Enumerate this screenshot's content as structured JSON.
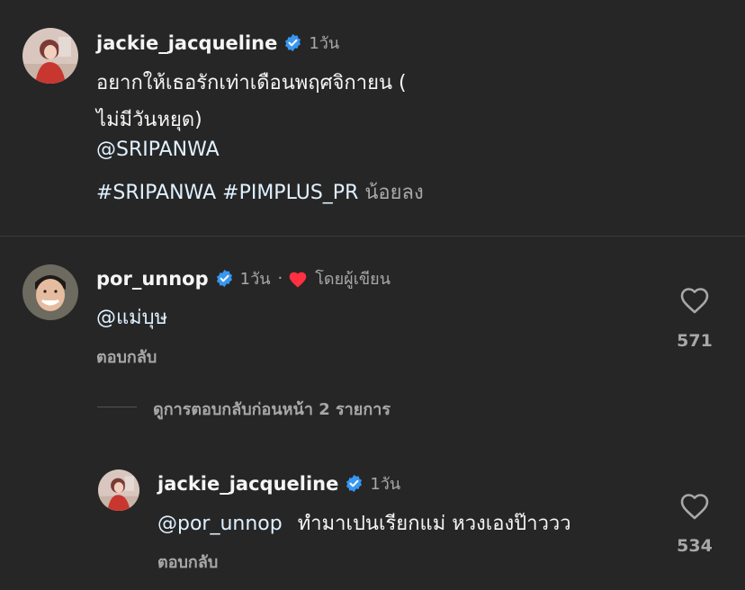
{
  "caption": {
    "username": "jackie_jacqueline",
    "time": "1วัน",
    "line1": "อยากให้เธอรักเท่าเดือนพฤศจิกายน (",
    "line2": "ไม่มีวันหยุด)",
    "mention": "@SRIPANWA",
    "hashtags": "#SRIPANWA #PIMPLUS_PR",
    "less_label": "น้อยลง"
  },
  "comment": {
    "username": "por_unnop",
    "time": "1วัน",
    "separator": "·",
    "liked_by_author": "โดยผู้เขียน",
    "text": "@แม่บุษ",
    "reply_label": "ตอบกลับ",
    "like_count": "571"
  },
  "view_replies": "ดูการตอบกลับก่อนหน้า 2 รายการ",
  "reply": {
    "username": "jackie_jacqueline",
    "time": "1วัน",
    "mention": "@por_unnop",
    "text": "ทำมาเปนเรียกแม่ หวงเองป๊าววว",
    "reply_label": "ตอบกลับ",
    "like_count": "534"
  },
  "colors": {
    "background": "#262626",
    "verified": "#3897f0",
    "heart_red": "#ff3040",
    "secondary_text": "#a8a8a8",
    "link_text": "#e0f1ff"
  },
  "icons": [
    "verified-badge-icon",
    "heart-icon",
    "liked-heart-icon"
  ]
}
